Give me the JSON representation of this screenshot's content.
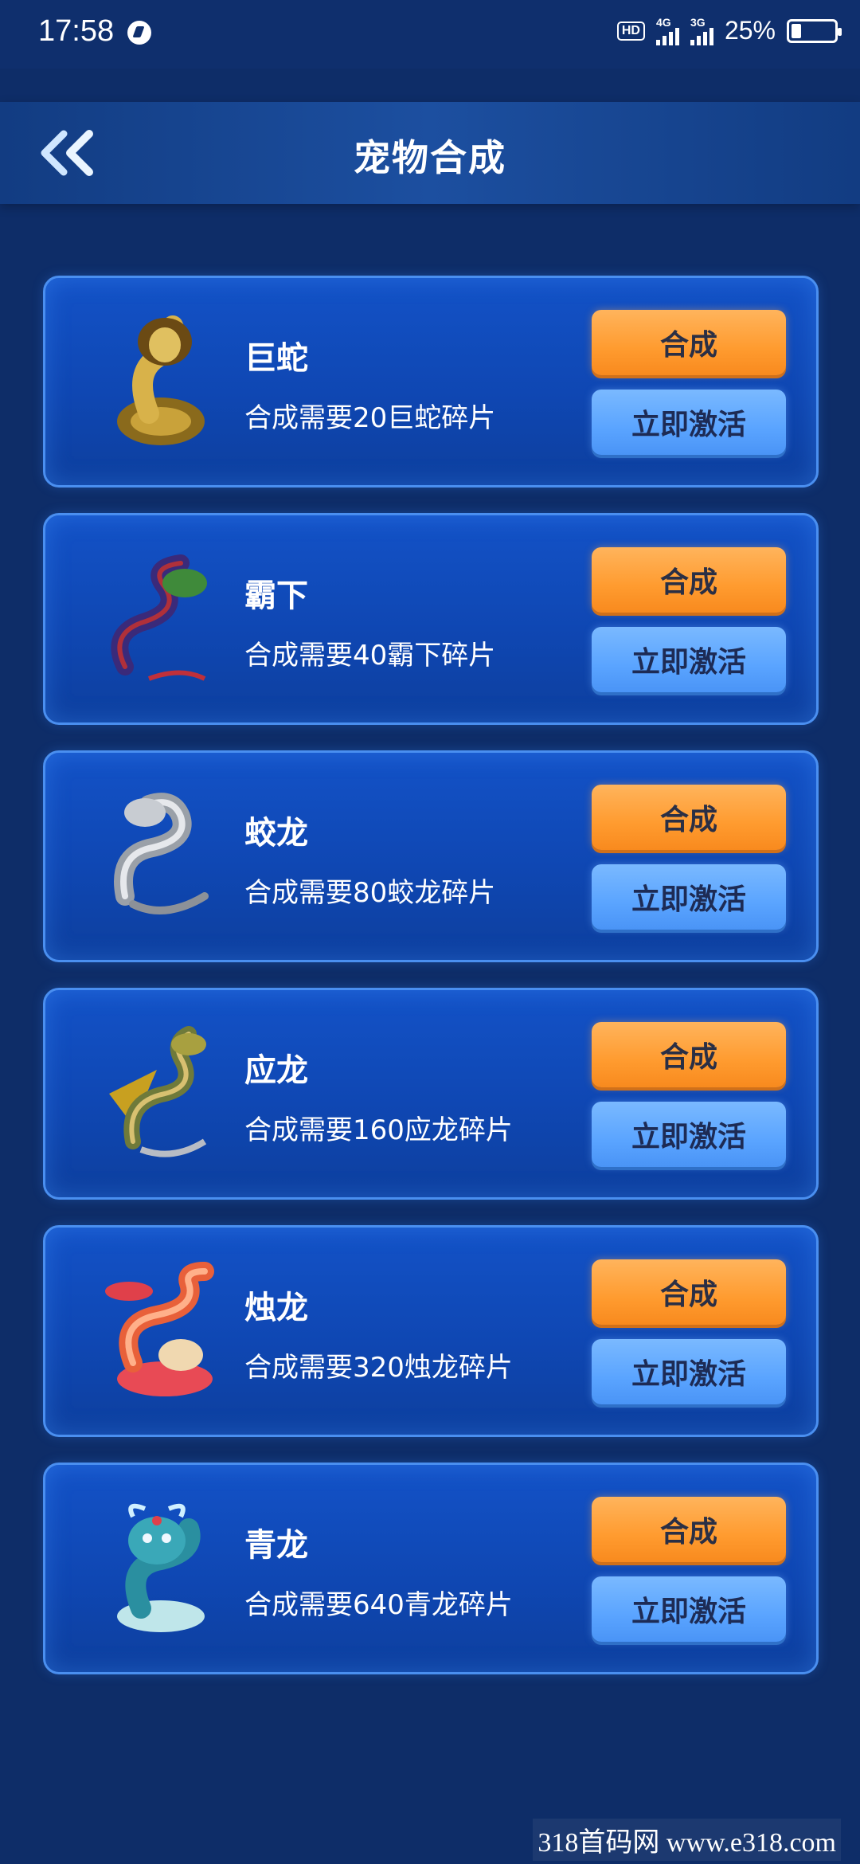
{
  "status_bar": {
    "time": "17:58",
    "hd": "HD",
    "net1": "4G",
    "net2": "3G",
    "battery": "25%"
  },
  "header": {
    "title": "宠物合成",
    "back_icon": "double-chevron-left-icon"
  },
  "pets": [
    {
      "name": "巨蛇",
      "requirement": "合成需要20巨蛇碎片",
      "synth_label": "合成",
      "activate_label": "立即激活",
      "icon": "cobra-icon"
    },
    {
      "name": "霸下",
      "requirement": "合成需要40霸下碎片",
      "synth_label": "合成",
      "activate_label": "立即激活",
      "icon": "dragon-bixi-icon"
    },
    {
      "name": "蛟龙",
      "requirement": "合成需要80蛟龙碎片",
      "synth_label": "合成",
      "activate_label": "立即激活",
      "icon": "silver-dragon-icon"
    },
    {
      "name": "应龙",
      "requirement": "合成需要160应龙碎片",
      "synth_label": "合成",
      "activate_label": "立即激活",
      "icon": "winged-dragon-icon"
    },
    {
      "name": "烛龙",
      "requirement": "合成需要320烛龙碎片",
      "synth_label": "合成",
      "activate_label": "立即激活",
      "icon": "red-dragon-icon"
    },
    {
      "name": "青龙",
      "requirement": "合成需要640青龙碎片",
      "synth_label": "合成",
      "activate_label": "立即激活",
      "icon": "azure-dragon-icon"
    }
  ],
  "colors": {
    "background": "#0e2d68",
    "card": "#1352c7",
    "card_border": "#4a8ff0",
    "synth_button": "#ff9b2f",
    "activate_button": "#5aa4ff"
  },
  "watermark": "318首码网  www.e318.com"
}
